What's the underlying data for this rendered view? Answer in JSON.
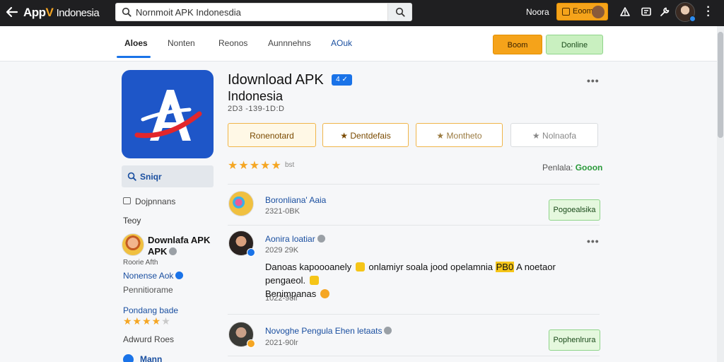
{
  "topbar": {
    "logo_mark": "App",
    "logo_v": "V",
    "logo_rest": "Indonesia",
    "search_value": "Nornmoit APK  Indonesdia",
    "link": "Noora",
    "button_label": "Eoom"
  },
  "tabs": [
    "Aloes",
    "Nonten",
    "Reonos",
    "Aunnnehns",
    "AOuk"
  ],
  "header_buttons": {
    "orange": "Boom",
    "green": "Donline"
  },
  "app": {
    "title": "Idownload APK",
    "badge": "4",
    "subtitle": "Indonesia",
    "date": "2D3 -139-1D:D",
    "pills": [
      "Ronenotard",
      "Dentdefais",
      "Montheto",
      "Nolnaofa"
    ],
    "rating_count": "bst",
    "reviews_label": "Penlala:",
    "reviews_value": "Gooon"
  },
  "sidebar": {
    "search_label": "Sniqr",
    "item1": "Dojpnnans",
    "section": "Teoy",
    "card_title_line1": "Downlafa APK",
    "card_title_line2": "APK",
    "card_meta": "Roorie Afth",
    "link1": "Nonense Aok",
    "item2": "Pennitiorame",
    "link2": "Pondang bade",
    "rating": 4,
    "item3": "Adwurd Roes",
    "link3": "Mann"
  },
  "reviews": [
    {
      "name": "Boronliana' Aaia",
      "meta": "2321-0BK",
      "action": "Pogoealsika"
    },
    {
      "name": "Aonira loatiar",
      "meta": "2029 29K",
      "comment_line1": "Danoas kapoooanely",
      "comment_mid": "onlamiyr soala jood opelamnia",
      "comment_hl": "PB0",
      "comment_end": "A noetaor pengaeol.",
      "comment_line2": "Benimpanas",
      "meta2": "1022-98lr"
    },
    {
      "name": "Novoghe Pengula Ehen letaats",
      "meta": "2021-90lr",
      "action": "Pophenlrura"
    }
  ]
}
